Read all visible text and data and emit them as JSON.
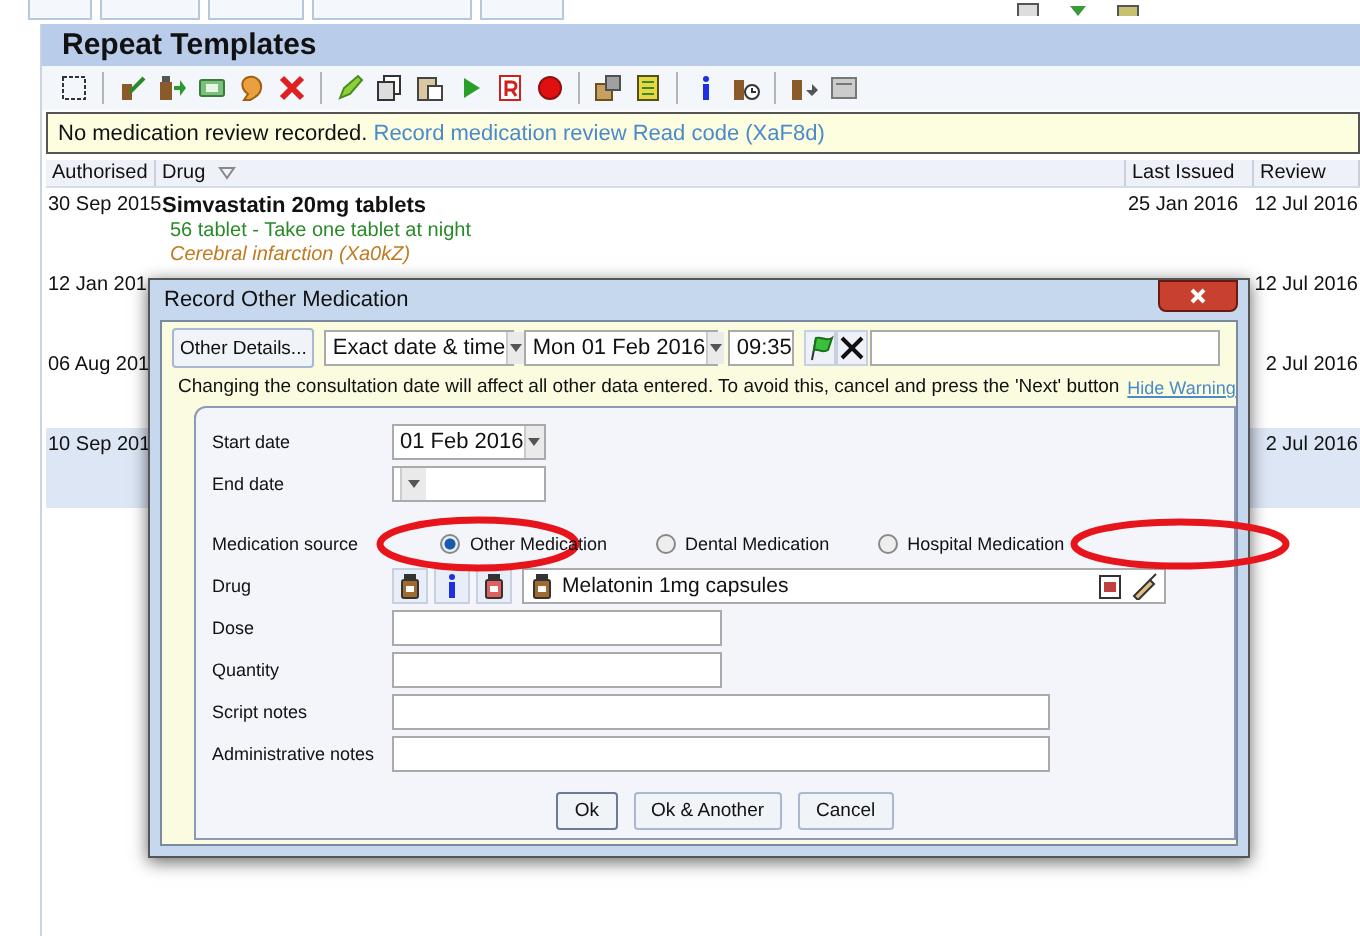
{
  "panel": {
    "title": "Repeat Templates"
  },
  "notice": {
    "text": "No medication review recorded.",
    "link": "Record medication review Read code (XaF8d)"
  },
  "table": {
    "columns": [
      {
        "label": "Authorised",
        "sortable": false
      },
      {
        "label": "Drug",
        "sortable": true
      },
      {
        "label": "Last Issued",
        "sortable": false
      },
      {
        "label": "Review",
        "sortable": false
      }
    ],
    "rows": [
      {
        "selected": false,
        "authorised": "30 Sep 2015",
        "drug": [
          {
            "kind": "name",
            "text": "Simvastatin 20mg tablets"
          },
          {
            "kind": "dosage",
            "text": "56 tablet - Take one tablet at night"
          },
          {
            "kind": "indication",
            "text": "Cerebral infarction (Xa0kZ)"
          }
        ],
        "last_issued": "25 Jan 2016",
        "review": "12 Jul 2016"
      },
      {
        "selected": false,
        "authorised": "12 Jan 201",
        "review": "12 Jul 2016"
      },
      {
        "selected": false,
        "authorised": "06 Aug 201",
        "review": "2 Jul 2016"
      },
      {
        "selected": true,
        "authorised": "10 Sep 201",
        "review": "2 Jul 2016"
      }
    ]
  },
  "dialog": {
    "title": "Record Other Medication",
    "other_details": "Other Details...",
    "date_mode": "Exact date & time",
    "date": "Mon 01 Feb 2016",
    "time": "09:35",
    "warning": "Changing the consultation date will affect all other data entered. To avoid this, cancel and press the 'Next' button",
    "hide_warning": "Hide Warning",
    "start_date": {
      "label": "Start date",
      "value": "01 Feb 2016"
    },
    "end_date": {
      "label": "End date"
    },
    "medication_source": {
      "label": "Medication source",
      "options": [
        {
          "label": "Other Medication",
          "selected": true
        },
        {
          "label": "Dental Medication",
          "selected": false
        },
        {
          "label": "Hospital Medication",
          "selected": false
        }
      ]
    },
    "drug": {
      "label": "Drug",
      "value": "Melatonin 1mg capsules"
    },
    "text_fields": [
      {
        "label": "Dose",
        "kind": "short"
      },
      {
        "label": "Quantity",
        "kind": "short"
      },
      {
        "label": "Script notes",
        "kind": "long"
      },
      {
        "label": "Administrative notes",
        "kind": "long"
      }
    ],
    "buttons": [
      "Ok",
      "Ok & Another",
      "Cancel"
    ]
  }
}
